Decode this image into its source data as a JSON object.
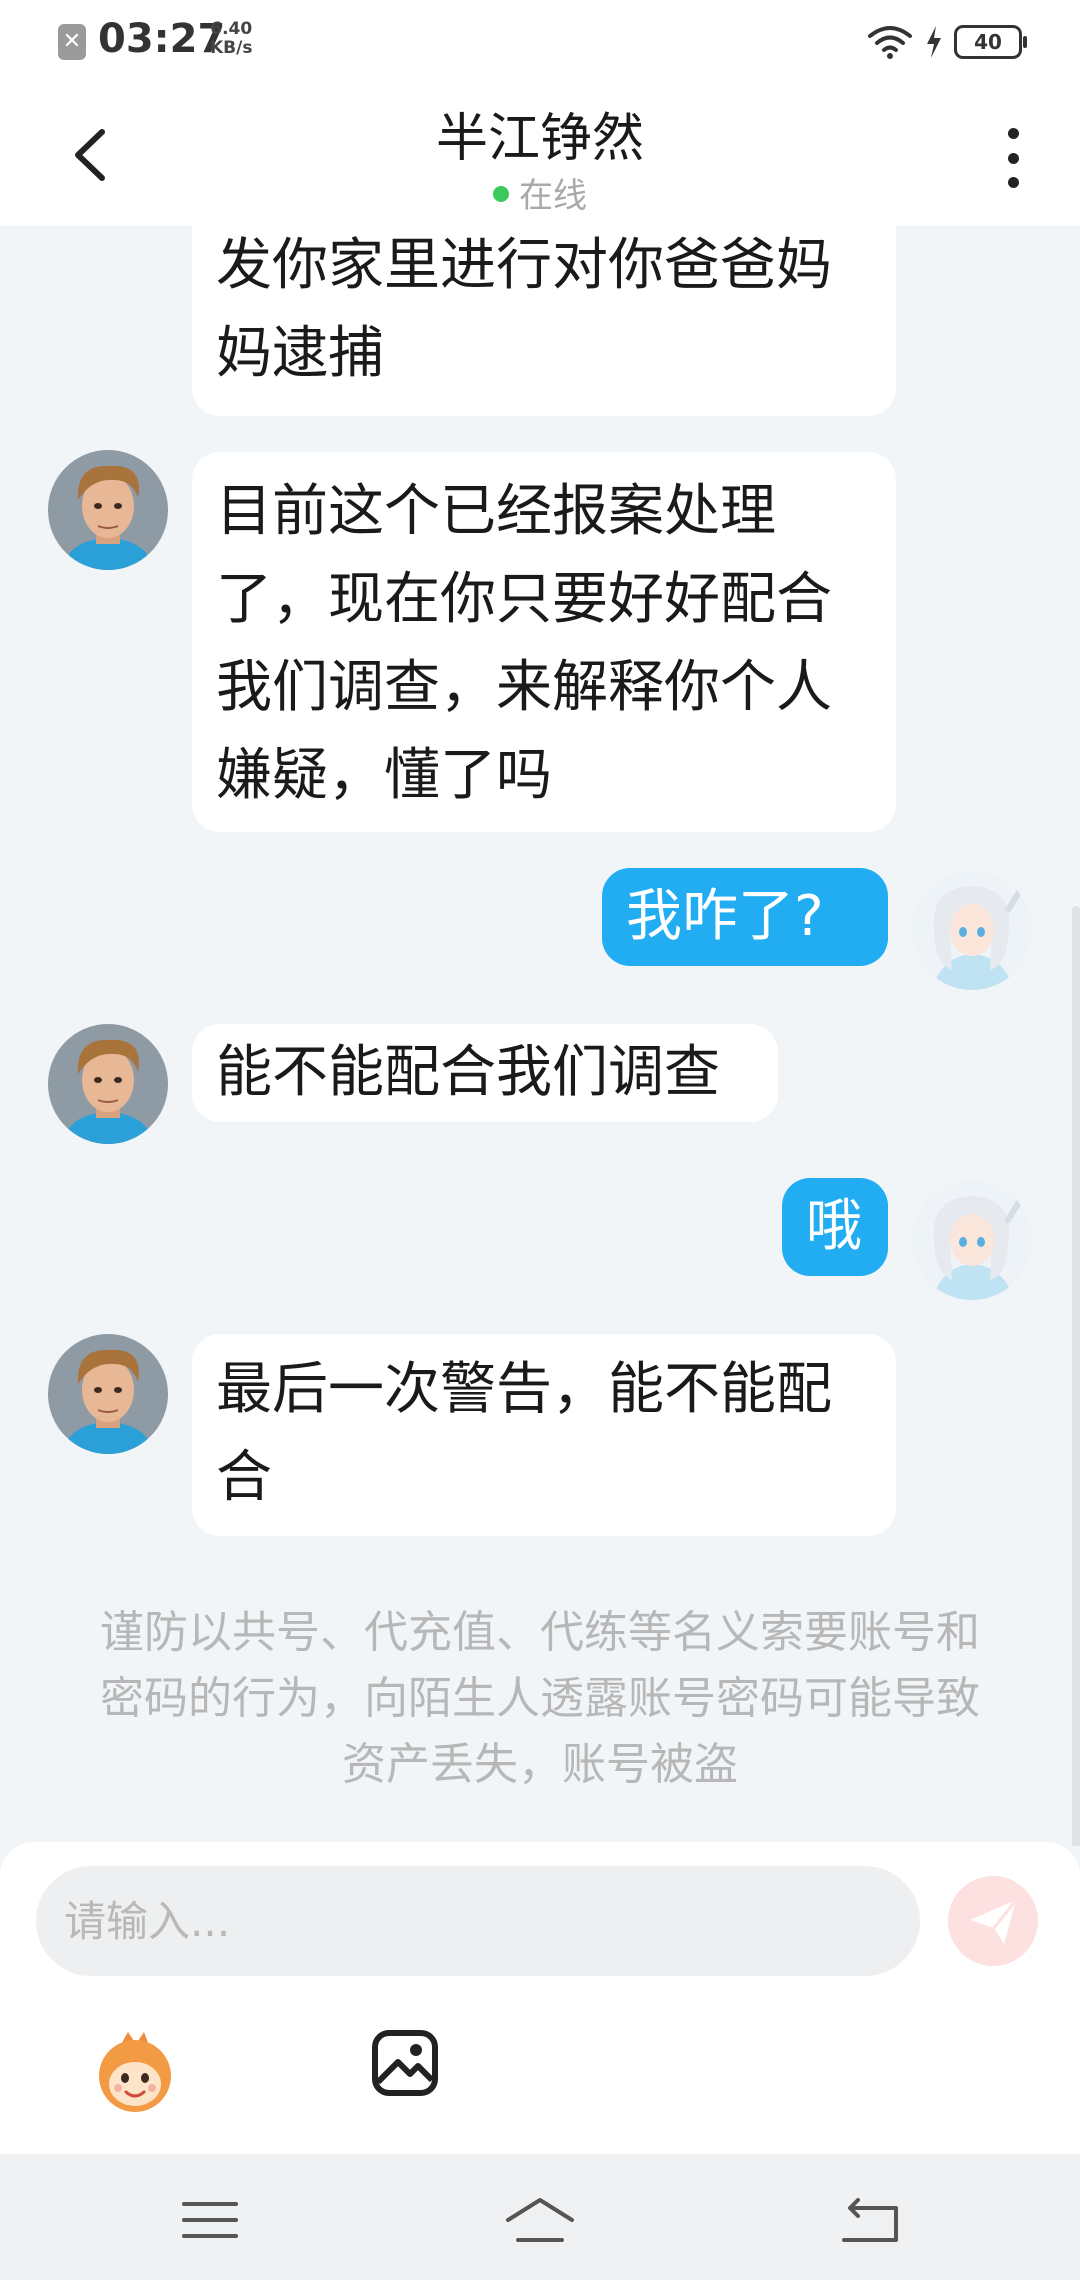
{
  "status_bar": {
    "time": "03:27",
    "net_speed_value": "6.40",
    "net_speed_unit": "KB/s",
    "battery": "40"
  },
  "header": {
    "contact_name": "半江铮然",
    "presence": "在线"
  },
  "messages": [
    {
      "side": "left",
      "text_lines": [
        "发你家里进行对你爸爸妈",
        "妈逮捕"
      ]
    },
    {
      "side": "left",
      "text_lines": [
        "目前这个已经报案处理",
        "了，现在你只要好好配合",
        "我们调查，来解释你个人",
        "嫌疑，懂了吗"
      ]
    },
    {
      "side": "right",
      "text_lines": [
        "我咋了?"
      ]
    },
    {
      "side": "left",
      "text_lines": [
        "能不能配合我们调查"
      ]
    },
    {
      "side": "right",
      "text_lines": [
        "哦"
      ]
    },
    {
      "side": "left",
      "text_lines": [
        "最后一次警告，能不能配",
        "合"
      ]
    }
  ],
  "notice": "谨防以共号、代充值、代练等名义索要账号和密码的行为，向陌生人透露账号密码可能导致资产丢失，账号被盗",
  "composer": {
    "placeholder": "请输入..."
  },
  "icons": {
    "back": "chevron-left-icon",
    "more": "more-vertical-icon",
    "send": "paper-plane-icon",
    "emoji": "emoji-sticker-icon",
    "image": "image-icon",
    "nav_menu": "menu-icon",
    "nav_home": "home-icon",
    "nav_back": "back-icon"
  },
  "colors": {
    "outgoing_bubble": "#22adf3",
    "incoming_bubble": "#ffffff",
    "chat_background": "#f2f5f8",
    "online_dot": "#3cc95b",
    "send_button": "#fde0e0"
  }
}
